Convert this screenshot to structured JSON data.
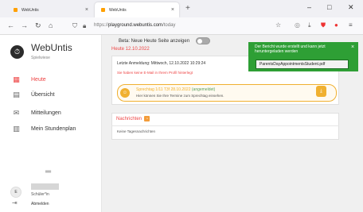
{
  "browser": {
    "tabs": [
      {
        "label": "WebUntis",
        "close": "×"
      },
      {
        "label": "WebUntis",
        "close": "×"
      }
    ],
    "new_tab": "+",
    "url_prefix": "https://",
    "url_host": "playground.webuntis.com",
    "url_path": "/today",
    "win_minimize": "–",
    "win_maximize": "□",
    "win_close": "✕"
  },
  "sidebar": {
    "brand": "WebUntis",
    "school": "Spielwiese",
    "items": [
      {
        "label": "Heute",
        "icon": "calendar-today-icon"
      },
      {
        "label": "Übersicht",
        "icon": "overview-icon"
      },
      {
        "label": "Mitteilungen",
        "icon": "mail-icon"
      },
      {
        "label": "Mein Stundenplan",
        "icon": "timetable-icon"
      }
    ],
    "avatar_initial": "E",
    "role": "Schüler*in",
    "logout": "Abmelden"
  },
  "main": {
    "beta_label": "Beta: Neue Heute Seite anzeigen",
    "today_label": "Heute 12.10.2022",
    "last_login": "Letzte Anmeldung: Mittwoch, 12.10.2022 10:29:24",
    "no_email": "Sie haben keine E-Mail in Ihrem Profil hinterlegt",
    "school_day_title": "Sprechtag 1/11 T3f 28.10.2022",
    "school_day_status": "(angemeldet)",
    "school_day_sub": "Hier können Sie Ihre Termine zum Sprechtag einsehen.",
    "messages_title": "Nachrichten",
    "no_messages": "Keine Tagesnachrichten"
  },
  "toast": {
    "text": "Der Bericht wurde erstellt und kann jetzt heruntergeladen werden",
    "file": "ParentsDayAppointmentsStudent.pdf",
    "close": "×"
  },
  "colors": {
    "accent": "#e44444",
    "toast": "#2e9f35",
    "school_day": "#f0b030"
  }
}
